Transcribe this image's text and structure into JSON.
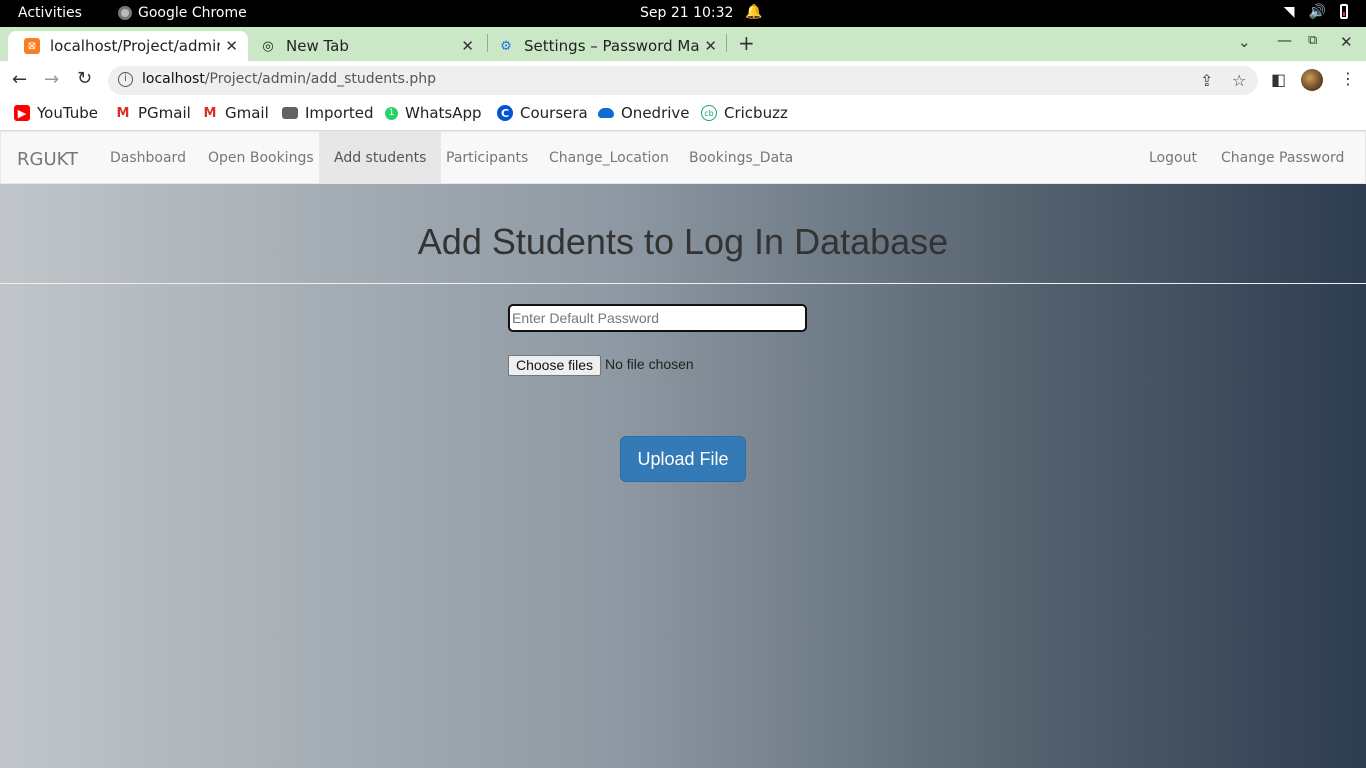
{
  "system": {
    "activities": "Activities",
    "app_name": "Google Chrome",
    "clock": "Sep 21  10:32"
  },
  "tabs": [
    {
      "title": "localhost/Project/admin/",
      "icon": "xampp-icon"
    },
    {
      "title": "New Tab",
      "icon": "chrome-icon"
    },
    {
      "title": "Settings – Password Mana",
      "icon": "gear-icon"
    }
  ],
  "omnibox": {
    "host": "localhost",
    "path": "/Project/admin/add_students.php"
  },
  "bookmarks": [
    {
      "label": "YouTube",
      "icon": "youtube-icon",
      "color": "#ff0000"
    },
    {
      "label": "PGmail",
      "icon": "gmail-icon",
      "color": "#d93025"
    },
    {
      "label": "Gmail",
      "icon": "gmail-icon",
      "color": "#d93025"
    },
    {
      "label": "Imported",
      "icon": "folder-icon",
      "color": "#5f6368"
    },
    {
      "label": "WhatsApp",
      "icon": "whatsapp-icon",
      "color": "#25d366"
    },
    {
      "label": "Coursera",
      "icon": "coursera-icon",
      "color": "#0056d2"
    },
    {
      "label": "Onedrive",
      "icon": "cloud-icon",
      "color": "#0a6ed1"
    },
    {
      "label": "Cricbuzz",
      "icon": "cricbuzz-icon",
      "color": "#1da084"
    }
  ],
  "navbar": {
    "brand": "RGUKT",
    "items": [
      "Dashboard",
      "Open Bookings",
      "Add students",
      "Participants",
      "Change_Location",
      "Bookings_Data"
    ],
    "active": "Add students",
    "right_items": [
      "Logout",
      "Change Password"
    ]
  },
  "main": {
    "heading": "Add Students to Log In Database",
    "password_placeholder": "Enter Default Password",
    "file_button": "Choose files",
    "file_status": "No file chosen",
    "upload_button": "Upload File"
  },
  "colors": {
    "tabstrip": "#cbe8c6",
    "primary_button": "#337ab7",
    "bg_gradient_start": "#c0c5c9",
    "bg_gradient_end": "#2d3c4f"
  }
}
